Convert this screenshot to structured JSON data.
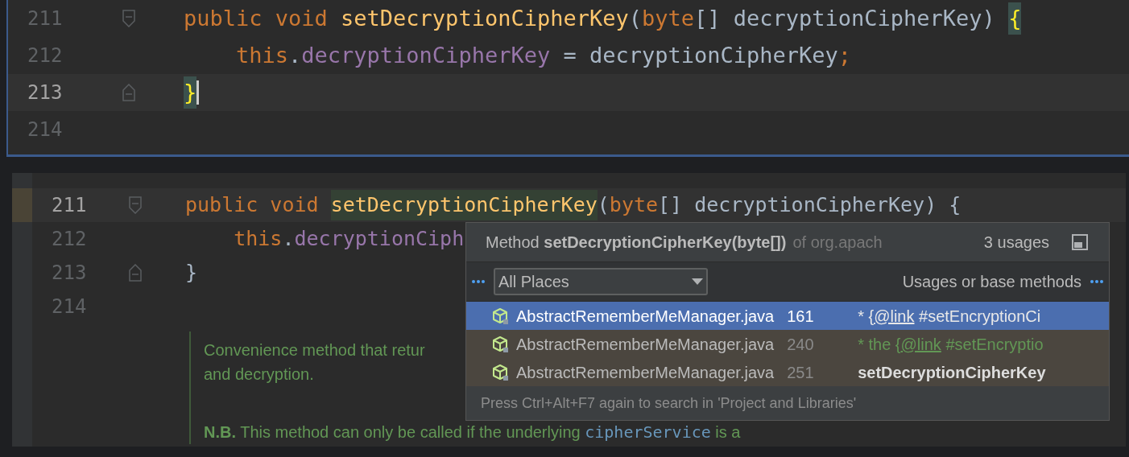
{
  "top_editor": {
    "lines": [
      {
        "number": "211",
        "current": false,
        "fold_start": true,
        "fold_end": false,
        "tokens": [
          {
            "kind": "keyword",
            "text": "public void "
          },
          {
            "kind": "method",
            "text": "setDecryptionCipherKey"
          },
          {
            "kind": "plain",
            "text": "("
          },
          {
            "kind": "keyword",
            "text": "byte"
          },
          {
            "kind": "plain",
            "text": "[] decryptionCipherKey) "
          },
          {
            "kind": "brace",
            "text": "{",
            "highlighted": true,
            "caret": false
          }
        ]
      },
      {
        "number": "212",
        "current": false,
        "indent": true,
        "fold_start": false,
        "fold_end": false,
        "tokens": [
          {
            "kind": "keyword",
            "text": "this"
          },
          {
            "kind": "plain",
            "text": "."
          },
          {
            "kind": "field",
            "text": "decryptionCipherKey"
          },
          {
            "kind": "plain",
            "text": " = decryptionCipherKey"
          },
          {
            "kind": "keyword",
            "text": ";"
          }
        ]
      },
      {
        "number": "213",
        "current": true,
        "fold_start": false,
        "fold_end": true,
        "tokens": [
          {
            "kind": "brace",
            "text": "}",
            "highlighted": true,
            "caret": true
          }
        ]
      },
      {
        "number": "214",
        "current": false,
        "fold_start": false,
        "fold_end": false
      }
    ]
  },
  "bottom_editor": {
    "lines": [
      {
        "number": "211",
        "current": true,
        "fold_start": true,
        "fold_end": false,
        "tokens": [
          {
            "kind": "keyword",
            "text": "public void "
          },
          {
            "kind": "method",
            "text": "setDecryptionCipherKey",
            "highlighted": true
          },
          {
            "kind": "plain",
            "text": "("
          },
          {
            "kind": "keyword",
            "text": "byte"
          },
          {
            "kind": "plain",
            "text": "[] decryptionCipherKey) {"
          }
        ]
      },
      {
        "number": "212",
        "current": false,
        "indent": true,
        "fold_start": false,
        "fold_end": false,
        "tokens": [
          {
            "kind": "keyword",
            "text": "this"
          },
          {
            "kind": "plain",
            "text": "."
          },
          {
            "kind": "field",
            "text": "decryptionCiph"
          }
        ]
      },
      {
        "number": "213",
        "current": false,
        "fold_start": false,
        "fold_end": true,
        "tokens": [
          {
            "kind": "plain",
            "text": "}"
          }
        ]
      },
      {
        "number": "214",
        "current": false,
        "fold_start": false,
        "fold_end": false
      }
    ],
    "doc_comment": [
      {
        "segments": [
          {
            "kind": "text",
            "text": "Convenience method that retur"
          }
        ]
      },
      {
        "segments": [
          {
            "kind": "text",
            "text": "and decryption."
          }
        ]
      },
      {
        "segments": [
          {
            "kind": "bold",
            "text": "N.B."
          },
          {
            "kind": "text",
            "text": " This method can only be called if the underlying "
          },
          {
            "kind": "code",
            "text": "cipherService"
          },
          {
            "kind": "text",
            "text": " is a"
          }
        ]
      }
    ]
  },
  "usages_popup": {
    "title": "Method **setDecryptionCipherKey(byte[])**",
    "qualifier": "of org.apach",
    "count": "3 usages",
    "scope": "All Places",
    "filter": "Usages or base methods",
    "rows": [
      {
        "file": "AbstractRememberMeManager.java",
        "line": "161",
        "selected": true,
        "preview": [
          {
            "kind": "comment",
            "text": "* {"
          },
          {
            "kind": "link",
            "text": "@link"
          },
          {
            "kind": "comment",
            "text": " #setEncryptionCi"
          }
        ]
      },
      {
        "file": "AbstractRememberMeManager.java",
        "line": "240",
        "selected": false,
        "preview": [
          {
            "kind": "comment",
            "text": "* the {"
          },
          {
            "kind": "link",
            "text": "@link"
          },
          {
            "kind": "comment",
            "text": " #setEncryptio"
          }
        ]
      },
      {
        "file": "AbstractRememberMeManager.java",
        "line": "251",
        "selected": false,
        "preview": [
          {
            "kind": "bold",
            "text": "setDecryptionCipherKey"
          }
        ]
      }
    ],
    "footer": "Press Ctrl+Alt+F7 again to search in 'Project and Libraries'"
  }
}
